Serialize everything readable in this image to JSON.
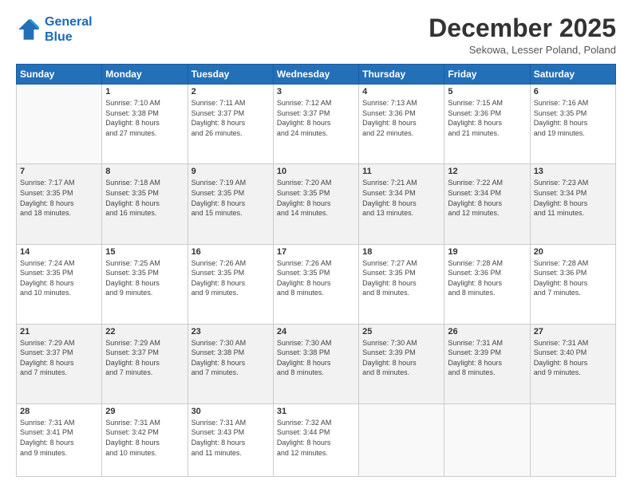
{
  "logo": {
    "line1": "General",
    "line2": "Blue"
  },
  "title": "December 2025",
  "subtitle": "Sekowa, Lesser Poland, Poland",
  "days_header": [
    "Sunday",
    "Monday",
    "Tuesday",
    "Wednesday",
    "Thursday",
    "Friday",
    "Saturday"
  ],
  "weeks": [
    [
      {
        "num": "",
        "info": ""
      },
      {
        "num": "1",
        "info": "Sunrise: 7:10 AM\nSunset: 3:38 PM\nDaylight: 8 hours\nand 27 minutes."
      },
      {
        "num": "2",
        "info": "Sunrise: 7:11 AM\nSunset: 3:37 PM\nDaylight: 8 hours\nand 26 minutes."
      },
      {
        "num": "3",
        "info": "Sunrise: 7:12 AM\nSunset: 3:37 PM\nDaylight: 8 hours\nand 24 minutes."
      },
      {
        "num": "4",
        "info": "Sunrise: 7:13 AM\nSunset: 3:36 PM\nDaylight: 8 hours\nand 22 minutes."
      },
      {
        "num": "5",
        "info": "Sunrise: 7:15 AM\nSunset: 3:36 PM\nDaylight: 8 hours\nand 21 minutes."
      },
      {
        "num": "6",
        "info": "Sunrise: 7:16 AM\nSunset: 3:35 PM\nDaylight: 8 hours\nand 19 minutes."
      }
    ],
    [
      {
        "num": "7",
        "info": "Sunrise: 7:17 AM\nSunset: 3:35 PM\nDaylight: 8 hours\nand 18 minutes."
      },
      {
        "num": "8",
        "info": "Sunrise: 7:18 AM\nSunset: 3:35 PM\nDaylight: 8 hours\nand 16 minutes."
      },
      {
        "num": "9",
        "info": "Sunrise: 7:19 AM\nSunset: 3:35 PM\nDaylight: 8 hours\nand 15 minutes."
      },
      {
        "num": "10",
        "info": "Sunrise: 7:20 AM\nSunset: 3:35 PM\nDaylight: 8 hours\nand 14 minutes."
      },
      {
        "num": "11",
        "info": "Sunrise: 7:21 AM\nSunset: 3:34 PM\nDaylight: 8 hours\nand 13 minutes."
      },
      {
        "num": "12",
        "info": "Sunrise: 7:22 AM\nSunset: 3:34 PM\nDaylight: 8 hours\nand 12 minutes."
      },
      {
        "num": "13",
        "info": "Sunrise: 7:23 AM\nSunset: 3:34 PM\nDaylight: 8 hours\nand 11 minutes."
      }
    ],
    [
      {
        "num": "14",
        "info": "Sunrise: 7:24 AM\nSunset: 3:35 PM\nDaylight: 8 hours\nand 10 minutes."
      },
      {
        "num": "15",
        "info": "Sunrise: 7:25 AM\nSunset: 3:35 PM\nDaylight: 8 hours\nand 9 minutes."
      },
      {
        "num": "16",
        "info": "Sunrise: 7:26 AM\nSunset: 3:35 PM\nDaylight: 8 hours\nand 9 minutes."
      },
      {
        "num": "17",
        "info": "Sunrise: 7:26 AM\nSunset: 3:35 PM\nDaylight: 8 hours\nand 8 minutes."
      },
      {
        "num": "18",
        "info": "Sunrise: 7:27 AM\nSunset: 3:35 PM\nDaylight: 8 hours\nand 8 minutes."
      },
      {
        "num": "19",
        "info": "Sunrise: 7:28 AM\nSunset: 3:36 PM\nDaylight: 8 hours\nand 8 minutes."
      },
      {
        "num": "20",
        "info": "Sunrise: 7:28 AM\nSunset: 3:36 PM\nDaylight: 8 hours\nand 7 minutes."
      }
    ],
    [
      {
        "num": "21",
        "info": "Sunrise: 7:29 AM\nSunset: 3:37 PM\nDaylight: 8 hours\nand 7 minutes."
      },
      {
        "num": "22",
        "info": "Sunrise: 7:29 AM\nSunset: 3:37 PM\nDaylight: 8 hours\nand 7 minutes."
      },
      {
        "num": "23",
        "info": "Sunrise: 7:30 AM\nSunset: 3:38 PM\nDaylight: 8 hours\nand 7 minutes."
      },
      {
        "num": "24",
        "info": "Sunrise: 7:30 AM\nSunset: 3:38 PM\nDaylight: 8 hours\nand 8 minutes."
      },
      {
        "num": "25",
        "info": "Sunrise: 7:30 AM\nSunset: 3:39 PM\nDaylight: 8 hours\nand 8 minutes."
      },
      {
        "num": "26",
        "info": "Sunrise: 7:31 AM\nSunset: 3:39 PM\nDaylight: 8 hours\nand 8 minutes."
      },
      {
        "num": "27",
        "info": "Sunrise: 7:31 AM\nSunset: 3:40 PM\nDaylight: 8 hours\nand 9 minutes."
      }
    ],
    [
      {
        "num": "28",
        "info": "Sunrise: 7:31 AM\nSunset: 3:41 PM\nDaylight: 8 hours\nand 9 minutes."
      },
      {
        "num": "29",
        "info": "Sunrise: 7:31 AM\nSunset: 3:42 PM\nDaylight: 8 hours\nand 10 minutes."
      },
      {
        "num": "30",
        "info": "Sunrise: 7:31 AM\nSunset: 3:43 PM\nDaylight: 8 hours\nand 11 minutes."
      },
      {
        "num": "31",
        "info": "Sunrise: 7:32 AM\nSunset: 3:44 PM\nDaylight: 8 hours\nand 12 minutes."
      },
      {
        "num": "",
        "info": ""
      },
      {
        "num": "",
        "info": ""
      },
      {
        "num": "",
        "info": ""
      }
    ]
  ]
}
